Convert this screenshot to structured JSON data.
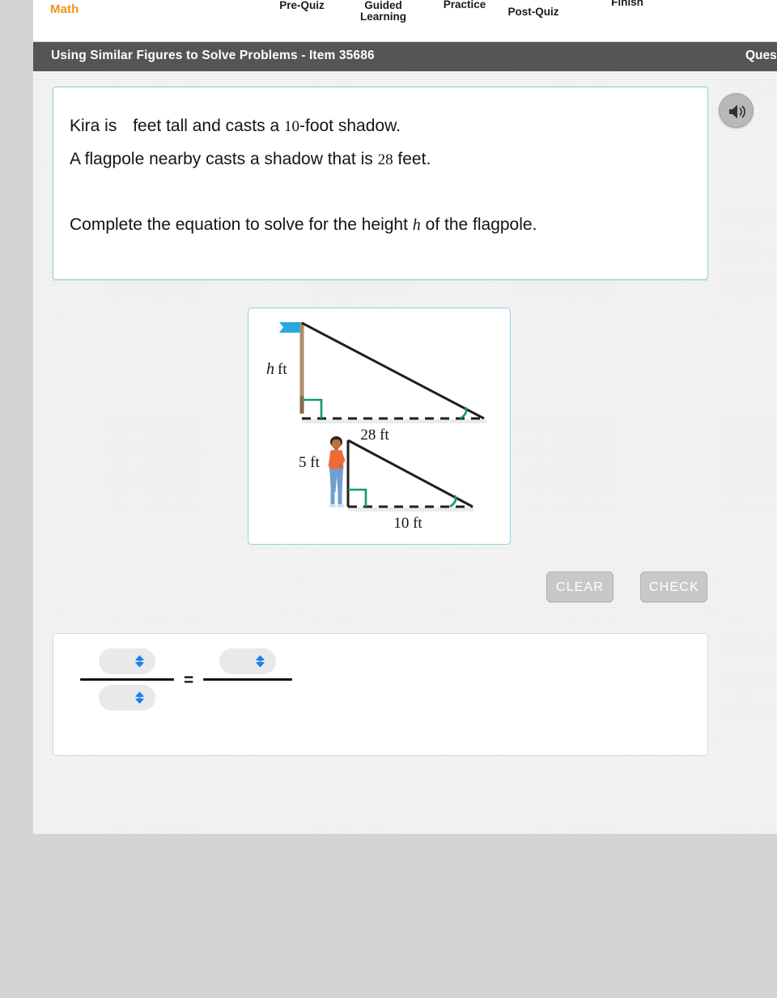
{
  "nav": {
    "brand": "Math",
    "steps": [
      {
        "label": "Pre-Quiz"
      },
      {
        "label": "Guided\nLearning"
      },
      {
        "label": "Practice"
      },
      {
        "label": "Post-Quiz"
      },
      {
        "label": "Finish"
      }
    ]
  },
  "titlebar": {
    "title": "Using Similar Figures to Solve Problems - Item 35686",
    "right_label": "Questio"
  },
  "stem": {
    "line1_a": "Kira is",
    "line1_blank": "",
    "line1_b": "feet tall and casts a",
    "line1_num": "10",
    "line1_c": "-foot shadow.",
    "line2_a": "A flagpole nearby casts a shadow that is",
    "line2_num": "28",
    "line2_b": "feet.",
    "line3_a": "Complete the equation to solve for the height",
    "line3_var": "h",
    "line3_b": "of the flagpole.",
    "speaker_icon": "speaker-icon"
  },
  "figure": {
    "flagpole_height_label": "h",
    "flagpole_height_unit": "ft",
    "flagpole_shadow_label": "28 ft",
    "person_height_label": "5 ft",
    "person_shadow_label": "10 ft",
    "colors": {
      "flag": "#29a8e0",
      "pole": "#b08d68",
      "pole_base": "#8a6a45",
      "line": "#1f1f1f",
      "angle_mark": "#0f9d68",
      "shirt": "#f06a37",
      "jeans": "#6f9fd0",
      "skin": "#b5743f",
      "hair": "#3d2418",
      "card_border": "#8ecfe0"
    }
  },
  "buttons": {
    "clear": "CLEAR",
    "check": "CHECK"
  },
  "equation": {
    "left_numerator": {
      "value": "",
      "icon": "chevron-updown-icon"
    },
    "left_denominator": {
      "value": "",
      "icon": "chevron-updown-icon"
    },
    "right_numerator": {
      "value": "",
      "icon": "chevron-updown-icon"
    },
    "right_denominator": {
      "value": ""
    },
    "equals": "=",
    "accent_color": "#1a7ff0"
  }
}
